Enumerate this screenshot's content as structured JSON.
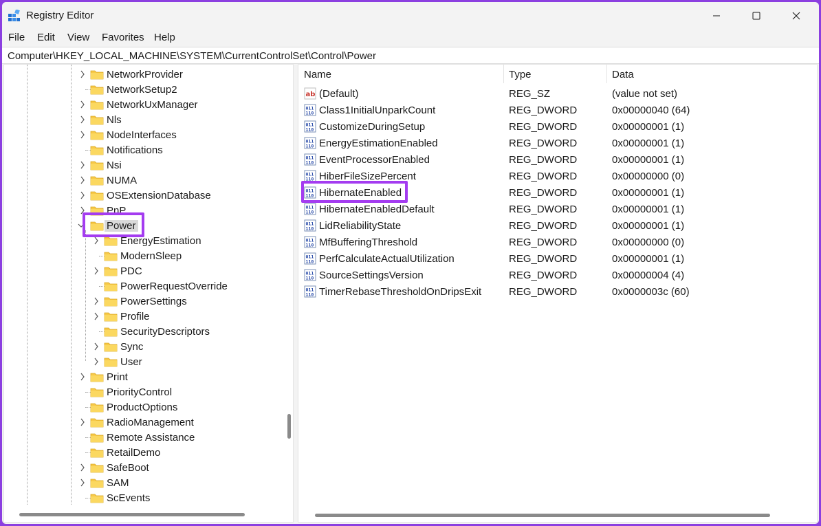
{
  "window": {
    "title": "Registry Editor"
  },
  "menu": {
    "items": [
      "File",
      "Edit",
      "View",
      "Favorites",
      "Help"
    ]
  },
  "address": {
    "path": "Computer\\HKEY_LOCAL_MACHINE\\SYSTEM\\CurrentControlSet\\Control\\Power"
  },
  "tree": {
    "items": [
      {
        "label": "NetworkProvider",
        "level": 1,
        "expandable": true
      },
      {
        "label": "NetworkSetup2",
        "level": 1,
        "expandable": false
      },
      {
        "label": "NetworkUxManager",
        "level": 1,
        "expandable": true
      },
      {
        "label": "Nls",
        "level": 1,
        "expandable": true
      },
      {
        "label": "NodeInterfaces",
        "level": 1,
        "expandable": true
      },
      {
        "label": "Notifications",
        "level": 1,
        "expandable": false
      },
      {
        "label": "Nsi",
        "level": 1,
        "expandable": true
      },
      {
        "label": "NUMA",
        "level": 1,
        "expandable": true
      },
      {
        "label": "OSExtensionDatabase",
        "level": 1,
        "expandable": true
      },
      {
        "label": "PnP",
        "level": 1,
        "expandable": true
      },
      {
        "label": "Power",
        "level": 1,
        "expandable": true,
        "selected": true
      },
      {
        "label": "EnergyEstimation",
        "level": 2,
        "expandable": true
      },
      {
        "label": "ModernSleep",
        "level": 2,
        "expandable": false
      },
      {
        "label": "PDC",
        "level": 2,
        "expandable": true
      },
      {
        "label": "PowerRequestOverride",
        "level": 2,
        "expandable": false
      },
      {
        "label": "PowerSettings",
        "level": 2,
        "expandable": true
      },
      {
        "label": "Profile",
        "level": 2,
        "expandable": true
      },
      {
        "label": "SecurityDescriptors",
        "level": 2,
        "expandable": false
      },
      {
        "label": "Sync",
        "level": 2,
        "expandable": true
      },
      {
        "label": "User",
        "level": 2,
        "expandable": true
      },
      {
        "label": "Print",
        "level": 1,
        "expandable": true
      },
      {
        "label": "PriorityControl",
        "level": 1,
        "expandable": false
      },
      {
        "label": "ProductOptions",
        "level": 1,
        "expandable": false
      },
      {
        "label": "RadioManagement",
        "level": 1,
        "expandable": true
      },
      {
        "label": "Remote Assistance",
        "level": 1,
        "expandable": false
      },
      {
        "label": "RetailDemo",
        "level": 1,
        "expandable": false
      },
      {
        "label": "SafeBoot",
        "level": 1,
        "expandable": true
      },
      {
        "label": "SAM",
        "level": 1,
        "expandable": true
      },
      {
        "label": "ScEvents",
        "level": 1,
        "expandable": false
      }
    ]
  },
  "values": {
    "columns": {
      "name": "Name",
      "type": "Type",
      "data": "Data"
    },
    "rows": [
      {
        "name": "(Default)",
        "type": "REG_SZ",
        "data": "(value not set)",
        "icon": "string-value-icon"
      },
      {
        "name": "Class1InitialUnparkCount",
        "type": "REG_DWORD",
        "data": "0x00000040 (64)",
        "icon": "binary-value-icon"
      },
      {
        "name": "CustomizeDuringSetup",
        "type": "REG_DWORD",
        "data": "0x00000001 (1)",
        "icon": "binary-value-icon"
      },
      {
        "name": "EnergyEstimationEnabled",
        "type": "REG_DWORD",
        "data": "0x00000001 (1)",
        "icon": "binary-value-icon"
      },
      {
        "name": "EventProcessorEnabled",
        "type": "REG_DWORD",
        "data": "0x00000001 (1)",
        "icon": "binary-value-icon"
      },
      {
        "name": "HiberFileSizePercent",
        "type": "REG_DWORD",
        "data": "0x00000000 (0)",
        "icon": "binary-value-icon"
      },
      {
        "name": "HibernateEnabled",
        "type": "REG_DWORD",
        "data": "0x00000001 (1)",
        "icon": "binary-value-icon",
        "highlighted": true
      },
      {
        "name": "HibernateEnabledDefault",
        "type": "REG_DWORD",
        "data": "0x00000001 (1)",
        "icon": "binary-value-icon"
      },
      {
        "name": "LidReliabilityState",
        "type": "REG_DWORD",
        "data": "0x00000001 (1)",
        "icon": "binary-value-icon"
      },
      {
        "name": "MfBufferingThreshold",
        "type": "REG_DWORD",
        "data": "0x00000000 (0)",
        "icon": "binary-value-icon"
      },
      {
        "name": "PerfCalculateActualUtilization",
        "type": "REG_DWORD",
        "data": "0x00000001 (1)",
        "icon": "binary-value-icon"
      },
      {
        "name": "SourceSettingsVersion",
        "type": "REG_DWORD",
        "data": "0x00000004 (4)",
        "icon": "binary-value-icon"
      },
      {
        "name": "TimerRebaseThresholdOnDripsExit",
        "type": "REG_DWORD",
        "data": "0x0000003c (60)",
        "icon": "binary-value-icon"
      }
    ]
  },
  "colors": {
    "highlight": "#a43cf0",
    "folder": "#f7c948",
    "frame": "#8b3fe0"
  }
}
